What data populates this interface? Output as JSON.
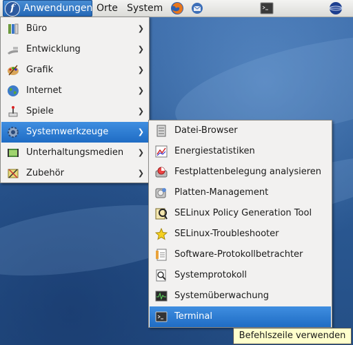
{
  "panel": {
    "applications_label": "Anwendungen",
    "places_label": "Orte",
    "system_label": "System",
    "launchers": [
      "firefox-icon",
      "thunderbird-icon",
      "terminal-icon"
    ],
    "network_icon": "globe-icon"
  },
  "main_menu": {
    "items": [
      {
        "label": "Büro",
        "icon": "office-icon",
        "has_submenu": true
      },
      {
        "label": "Entwicklung",
        "icon": "development-icon",
        "has_submenu": true
      },
      {
        "label": "Grafik",
        "icon": "graphics-icon",
        "has_submenu": true
      },
      {
        "label": "Internet",
        "icon": "internet-icon",
        "has_submenu": true
      },
      {
        "label": "Spiele",
        "icon": "games-icon",
        "has_submenu": true
      },
      {
        "label": "Systemwerkzeuge",
        "icon": "system-tools-icon",
        "has_submenu": true,
        "selected": true
      },
      {
        "label": "Unterhaltungsmedien",
        "icon": "multimedia-icon",
        "has_submenu": true
      },
      {
        "label": "Zubehör",
        "icon": "accessories-icon",
        "has_submenu": true
      }
    ]
  },
  "sub_menu": {
    "items": [
      {
        "label": "Datei-Browser",
        "icon": "file-browser-icon"
      },
      {
        "label": "Energiestatistiken",
        "icon": "power-stats-icon"
      },
      {
        "label": "Festplattenbelegung analysieren",
        "icon": "disk-usage-icon"
      },
      {
        "label": "Platten-Management",
        "icon": "disk-management-icon"
      },
      {
        "label": "SELinux Policy Generation Tool",
        "icon": "selinux-policy-icon"
      },
      {
        "label": "SELinux-Troubleshooter",
        "icon": "star-icon"
      },
      {
        "label": "Software-Protokollbetrachter",
        "icon": "log-viewer-icon"
      },
      {
        "label": "Systemprotokoll",
        "icon": "system-log-icon"
      },
      {
        "label": "Systemüberwachung",
        "icon": "system-monitor-icon"
      },
      {
        "label": "Terminal",
        "icon": "terminal-icon",
        "selected": true
      }
    ]
  },
  "tooltip": "Befehlszeile verwenden"
}
